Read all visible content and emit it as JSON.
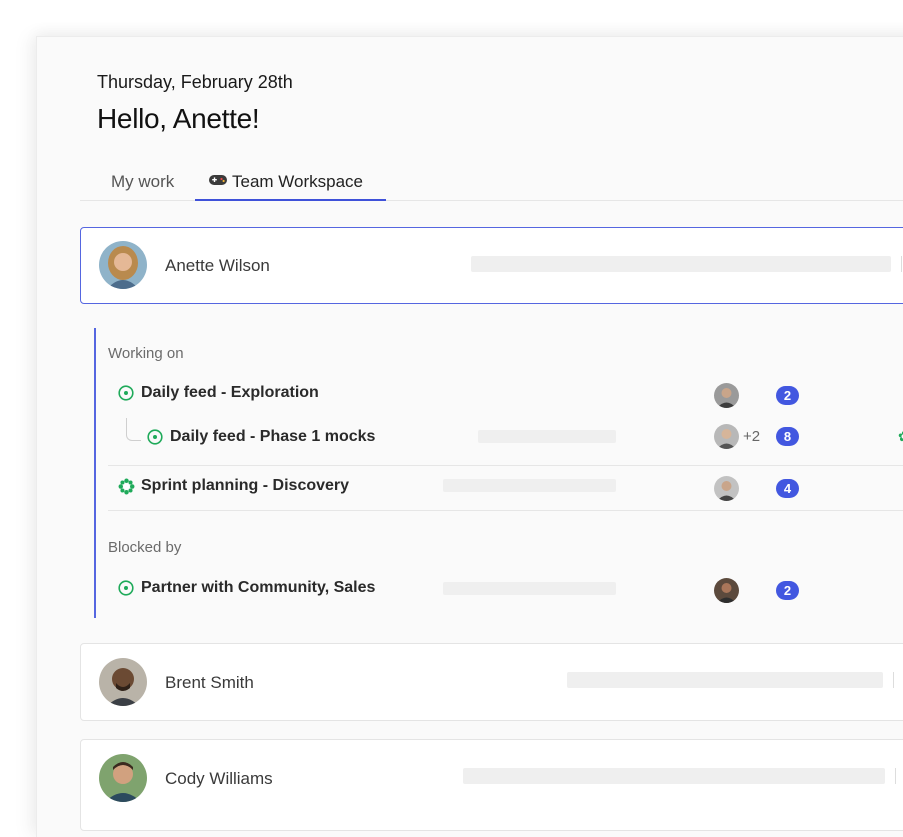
{
  "header": {
    "date": "Thursday, February 28th",
    "greeting": "Hello, Anette!"
  },
  "tabs": [
    {
      "label": "My work",
      "active": false
    },
    {
      "label": "Team Workspace",
      "icon": "gamepad-icon",
      "active": true
    }
  ],
  "members": [
    {
      "name": "Anette Wilson",
      "expanded": true
    },
    {
      "name": "Brent Smith",
      "expanded": false
    },
    {
      "name": "Cody Williams",
      "expanded": false
    }
  ],
  "detail": {
    "working_on_label": "Working on",
    "blocked_by_label": "Blocked by",
    "tasks": [
      {
        "title": "Daily feed - Exploration",
        "status_icon": "circle-dot-icon",
        "comments": "2"
      },
      {
        "title": "Daily feed - Phase 1 mocks",
        "status_icon": "circle-dot-icon",
        "extra_assignees": "+2",
        "comments": "8"
      },
      {
        "title": "Sprint planning - Discovery",
        "status_icon": "sparkle-gear-icon",
        "comments": "4"
      },
      {
        "title": "Partner with Community, Sales",
        "status_icon": "circle-dot-icon",
        "comments": "2"
      }
    ]
  },
  "colors": {
    "accent": "#4257e0",
    "status_green": "#1faa5a",
    "border_selected": "#5566e0"
  }
}
